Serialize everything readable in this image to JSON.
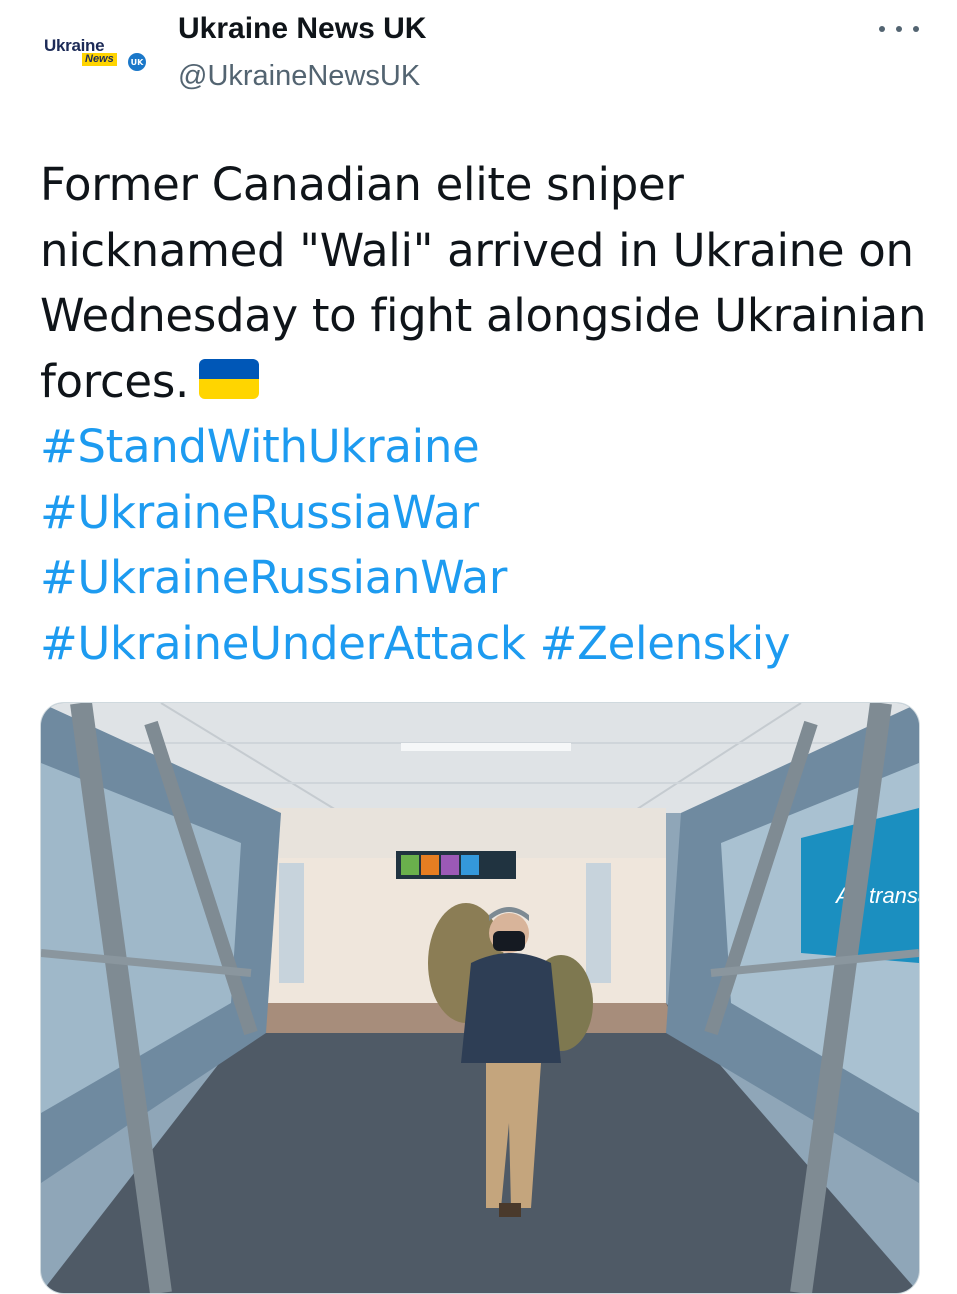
{
  "tweet": {
    "avatar": {
      "line1": "Ukraine",
      "line2": "News",
      "badge": "UK",
      "colors": {
        "navy": "#1d2b57",
        "yellow": "#ffd400",
        "blue": "#1b78c9"
      }
    },
    "display_name": "Ukraine News UK",
    "handle": "@UkraineNewsUK",
    "more_icon": "more-horizontal-icon",
    "text": "Former Canadian elite sniper nicknamed \"Wali\" arrived in Ukraine on Wednesday to fight alongside Ukrainian forces.",
    "flag_icon": "ukraine-flag-icon",
    "flag_colors": {
      "blue": "#0057b7",
      "yellow": "#ffd500"
    },
    "hashtags": [
      "#StandWithUkraine",
      "#UkraineRussiaWar",
      "#UkraineRussianWar",
      "#UkraineUnderAttack",
      "#Zelenskiy"
    ],
    "hashtag_color": "#1d9bf0",
    "media": {
      "sign_text": "Air transat"
    }
  }
}
